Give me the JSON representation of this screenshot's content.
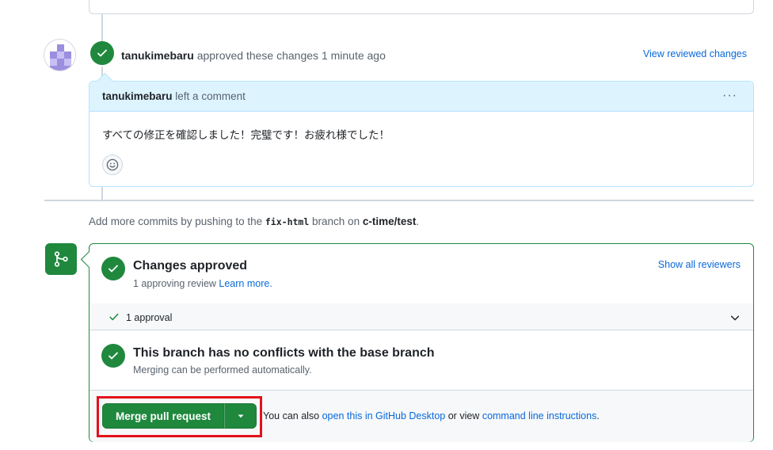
{
  "review_event": {
    "author": "tanukimebaru",
    "action": "approved these changes",
    "time": "1 minute ago",
    "view_link": "View reviewed changes"
  },
  "comment": {
    "author": "tanukimebaru",
    "action": "left a comment",
    "menu": "···",
    "body": "すべての修正を確認しました！完璧です！お疲れ様でした！"
  },
  "hint": {
    "prefix": "Add more commits by pushing to the",
    "branch": "fix-html",
    "middle": "branch on",
    "repo": "c-time/test",
    "suffix": "."
  },
  "merge_box": {
    "approved": {
      "title": "Changes approved",
      "subtitle": "1 approving review",
      "learn_more": "Learn more.",
      "show_reviewers": "Show all reviewers"
    },
    "approvals": {
      "label": "1 approval"
    },
    "conflicts": {
      "title": "This branch has no conflicts with the base branch",
      "subtitle": "Merging can be performed automatically."
    },
    "actions": {
      "merge_label": "Merge pull request",
      "also_prefix": "You can also",
      "desktop_link": "open this in GitHub Desktop",
      "or_view": "or view",
      "cli_link": "command line instructions",
      "suffix": "."
    }
  },
  "colors": {
    "success": "#1f883d",
    "link": "#0969da",
    "highlight": "#e3101b",
    "comment_header": "#ddf4ff"
  },
  "icons": {
    "avatar": "identicon-avatar",
    "approved_badge": "check-circle-icon",
    "merge": "git-merge-icon",
    "reaction": "smiley-icon",
    "dropdown": "triangle-down-icon",
    "expand": "chevron-down-icon"
  }
}
